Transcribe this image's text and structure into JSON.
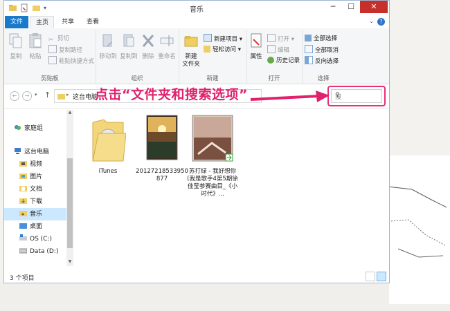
{
  "window": {
    "title": "音乐"
  },
  "tabs": {
    "file": "文件",
    "home": "主页",
    "share": "共享",
    "view": "查看"
  },
  "ribbon": {
    "clipboard": {
      "label": "剪贴板",
      "copy": "复制",
      "paste": "粘贴",
      "cut": "剪切",
      "copy_path": "复制路径",
      "paste_shortcut": "粘贴快捷方式"
    },
    "organize": {
      "label": "组织",
      "move_to": "移动到",
      "copy_to": "复制到",
      "delete": "删除",
      "rename": "重命名"
    },
    "new": {
      "label": "新建",
      "new_folder": "新建\n文件夹",
      "new_item": "新建项目",
      "easy_access": "轻松访问"
    },
    "open": {
      "label": "打开",
      "properties": "属性",
      "open": "打开",
      "edit": "编辑",
      "history": "历史记录"
    },
    "select": {
      "label": "选择",
      "select_all": "全部选择",
      "select_none": "全部取消",
      "invert": "反向选择"
    }
  },
  "address": {
    "crumb": "这台电脑"
  },
  "search": {
    "placeholder": "搜"
  },
  "annotation": {
    "text": "点击“文件夹和搜索选项”"
  },
  "nav": {
    "homegroup": "家庭组",
    "this_pc": "这台电脑",
    "items": [
      "视频",
      "图片",
      "文档",
      "下载",
      "音乐",
      "桌面",
      "OS (C:)",
      "Data (D:)"
    ]
  },
  "files": [
    {
      "name": "iTunes",
      "kind": "folder"
    },
    {
      "name": "20127218533950877",
      "kind": "image"
    },
    {
      "name": "苏打绿 - 我好想你 (我是歌手4第5期徐佳莹参赛曲目_《小时代》...",
      "kind": "video"
    }
  ],
  "status": {
    "count": "3 个项目"
  },
  "colors": {
    "accent": "#1979ca",
    "annotation": "#e0226e",
    "close": "#c7302a",
    "selection": "#cce8ff"
  }
}
